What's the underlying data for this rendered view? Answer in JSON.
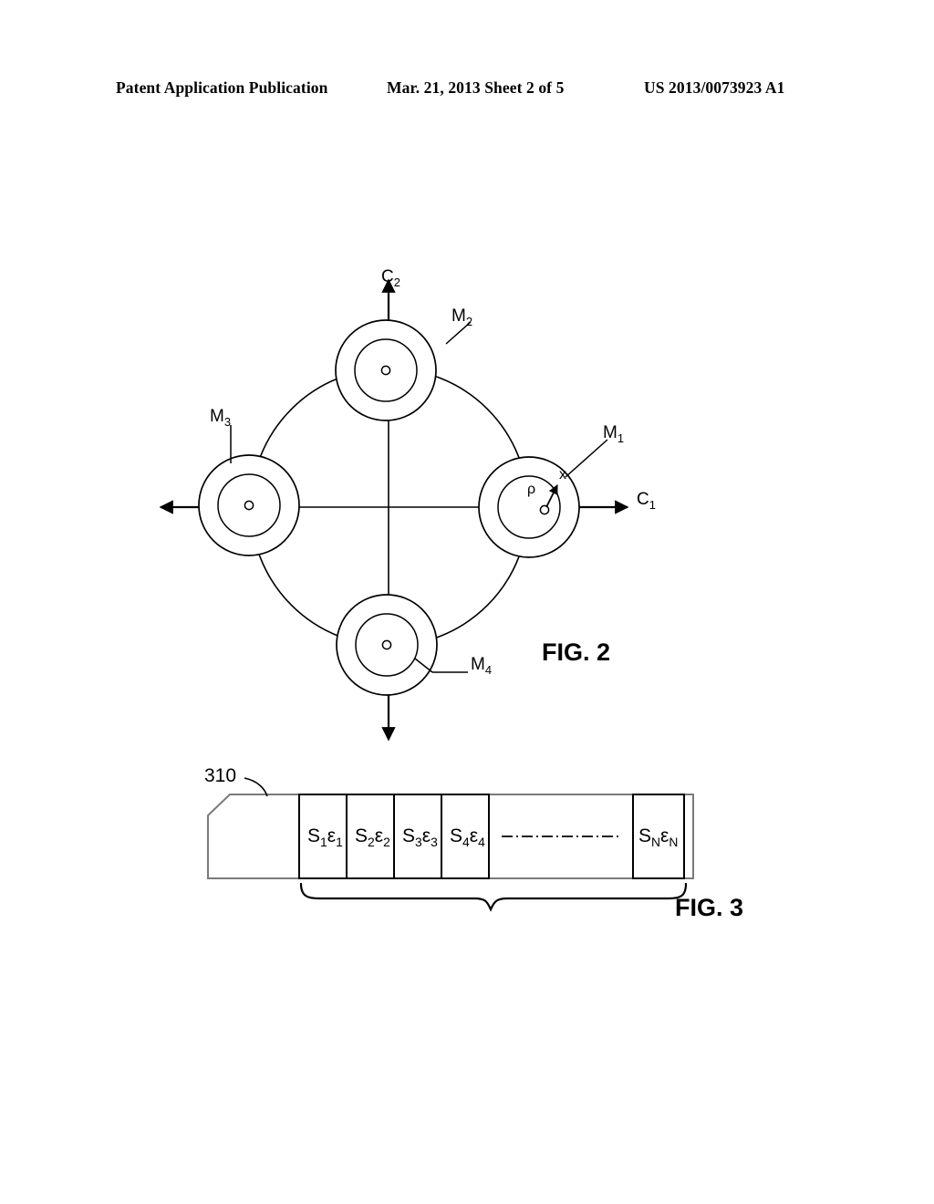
{
  "header": {
    "left": "Patent Application Publication",
    "middle": "Mar. 21, 2013  Sheet 2 of 5",
    "right": "US 2013/0073923 A1"
  },
  "figures": [
    {
      "caption": "FIG. 2",
      "description": "Four motor assemblies arranged on a circle with orthogonal control axes",
      "axes": [
        {
          "name": "C1",
          "label": "C",
          "sub": "1",
          "direction": "right"
        },
        {
          "name": "C2",
          "label": "C",
          "sub": "2",
          "direction": "up"
        }
      ],
      "motors": [
        {
          "name": "M1",
          "label": "M",
          "sub": "1",
          "position": "right"
        },
        {
          "name": "M2",
          "label": "M",
          "sub": "2",
          "position": "top"
        },
        {
          "name": "M3",
          "label": "M",
          "sub": "3",
          "position": "left"
        },
        {
          "name": "M4",
          "label": "M",
          "sub": "4",
          "position": "bottom"
        }
      ],
      "annotations": [
        {
          "name": "rho",
          "label": "ρ"
        },
        {
          "name": "x",
          "label": "x"
        }
      ]
    },
    {
      "caption": "FIG. 3",
      "description": "Segmented data strip with sample/epsilon pairs",
      "ref_number": "310",
      "cells": [
        {
          "label": "S",
          "sub1": "1",
          "eps": "ε",
          "sub2": "1"
        },
        {
          "label": "S",
          "sub1": "2",
          "eps": "ε",
          "sub2": "2"
        },
        {
          "label": "S",
          "sub1": "3",
          "eps": "ε",
          "sub2": "3"
        },
        {
          "label": "S",
          "sub1": "4",
          "eps": "ε",
          "sub2": "4"
        },
        {
          "label": "S",
          "sub1": "N",
          "eps": "ε",
          "sub2": "N"
        }
      ],
      "ellipsis": "dash-dot-line"
    }
  ],
  "colors": {
    "ink": "#000000",
    "paper": "#ffffff",
    "gray_rule": "#808080"
  }
}
